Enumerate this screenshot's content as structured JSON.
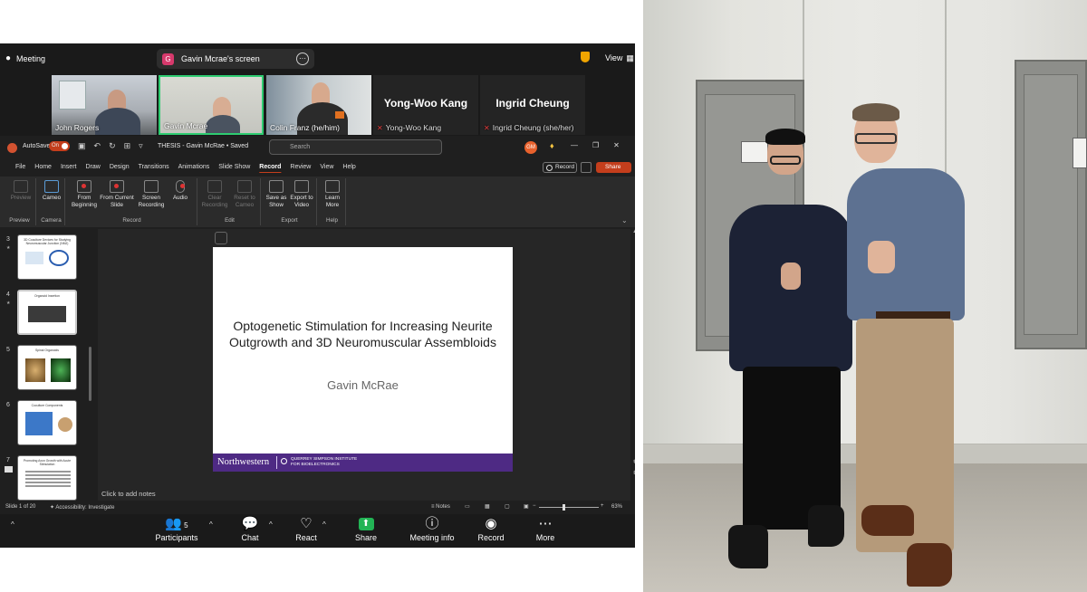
{
  "zoom": {
    "meeting_label": "Meeting",
    "screen_share_badge": "G",
    "screen_share_label": "Gavin Mcrae's screen",
    "view_label": "View",
    "participants": [
      {
        "name": "John Rogers",
        "video": true
      },
      {
        "name": "Gavin Mcrae",
        "video": true,
        "speaking": true
      },
      {
        "name": "Colin Franz (he/him)",
        "video": true
      },
      {
        "name": "Yong-Woo Kang",
        "big": "Yong-Woo Kang",
        "video": false,
        "muted": true
      },
      {
        "name": "Ingrid Cheung (she/her)",
        "big": "Ingrid Cheung",
        "video": false,
        "muted": true
      }
    ],
    "toolbar": {
      "participants_count": "5",
      "participants": "Participants",
      "chat": "Chat",
      "react": "React",
      "share": "Share",
      "meeting_info": "Meeting info",
      "record": "Record",
      "more": "More"
    }
  },
  "ppt": {
    "autosave": "AutoSave",
    "autosave_state": "On",
    "doc_title": "THESIS - Gavin McRae • Saved",
    "search_placeholder": "Search",
    "user_initials": "GM",
    "menu": [
      "File",
      "Home",
      "Insert",
      "Draw",
      "Design",
      "Transitions",
      "Animations",
      "Slide Show",
      "Record",
      "Review",
      "View",
      "Help"
    ],
    "active_menu": "Record",
    "record_button": "Record",
    "share_button": "Share",
    "ribbon": {
      "preview": "Preview",
      "cameo": "Cameo",
      "from_beginning": "From Beginning",
      "from_current": "From Current Slide",
      "screen_recording": "Screen Recording",
      "audio": "Audio",
      "clear_recording": "Clear Recording",
      "reset_to_cameo": "Reset to Cameo",
      "save_as_show": "Save as Show",
      "export_to_video": "Export to Video",
      "learn_more": "Learn More",
      "groups": {
        "preview": "Preview",
        "camera": "Camera",
        "record": "Record",
        "edit": "Edit",
        "export": "Export",
        "help": "Help"
      }
    },
    "thumbnails": [
      {
        "num": "3",
        "title": "3D Coculture Devices for Studying Neuromuscular Junction (NMJ)"
      },
      {
        "num": "4",
        "title": "Organoid Insertion"
      },
      {
        "num": "5",
        "title": "Spinal Organoids"
      },
      {
        "num": "6",
        "title": "Coculture Components"
      },
      {
        "num": "7",
        "title": "Promoting Axon Growth with Acute Stimulation"
      }
    ],
    "slide": {
      "title": "Optogenetic Stimulation for Increasing Neurite Outgrowth and 3D Neuromuscular Assembloids",
      "author": "Gavin McRae",
      "footer_logo": "Northwestern",
      "footer_institute": "QUERREY SIMPSON INSTITUTE FOR BIOELECTRONICS"
    },
    "notes_placeholder": "Click to add notes",
    "status": {
      "slide_of": "Slide 1 of 20",
      "accessibility": "Accessibility: Investigate",
      "notes": "Notes",
      "zoom": "63%"
    },
    "colors": {
      "accent": "#c43e1c",
      "northwestern_purple": "#4e2a84"
    }
  }
}
